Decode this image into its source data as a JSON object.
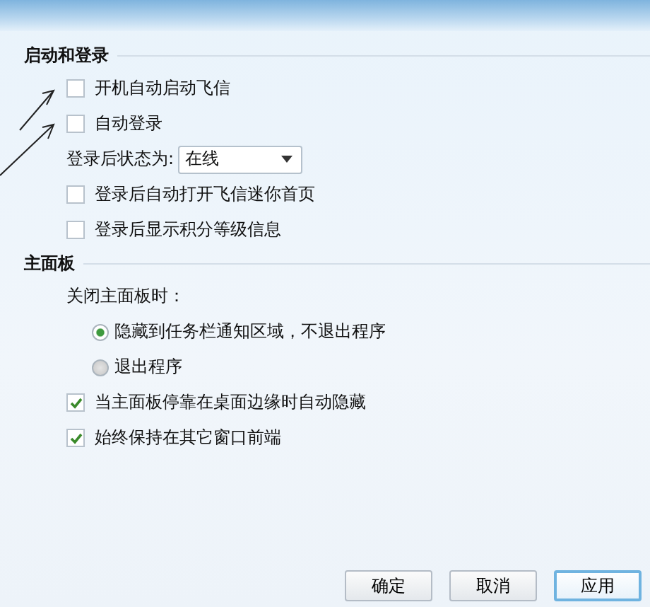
{
  "sections": [
    {
      "title": "启动和登录",
      "items": [
        {
          "kind": "checkbox",
          "label": "开机自动启动飞信",
          "checked": false
        },
        {
          "kind": "checkbox",
          "label": "自动登录",
          "checked": false
        },
        {
          "kind": "dropdown",
          "label": "登录后状态为:",
          "value": "在线"
        },
        {
          "kind": "checkbox",
          "label": "登录后自动打开飞信迷你首页",
          "checked": false
        },
        {
          "kind": "checkbox",
          "label": "登录后显示积分等级信息",
          "checked": false
        }
      ]
    },
    {
      "title": "主面板",
      "items": [
        {
          "kind": "label",
          "label": "关闭主面板时："
        },
        {
          "kind": "radio",
          "label": "隐藏到任务栏通知区域，不退出程序",
          "selected": true
        },
        {
          "kind": "radio",
          "label": "退出程序",
          "selected": false
        },
        {
          "kind": "checkbox",
          "label": "当主面板停靠在桌面边缘时自动隐藏",
          "checked": true
        },
        {
          "kind": "checkbox",
          "label": "始终保持在其它窗口前端",
          "checked": true
        }
      ]
    }
  ],
  "buttons": [
    {
      "label": "确定",
      "focused": false
    },
    {
      "label": "取消",
      "focused": false
    },
    {
      "label": "应用",
      "focused": true
    }
  ]
}
